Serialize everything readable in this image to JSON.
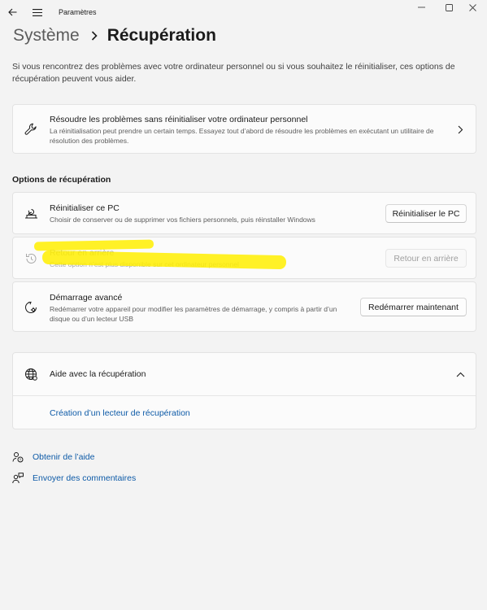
{
  "window": {
    "title": "Paramètres"
  },
  "breadcrumb": {
    "parent": "Système",
    "current": "Récupération"
  },
  "intro": "Si vous rencontrez des problèmes avec votre ordinateur personnel ou si vous souhaitez le réinitialiser, ces options de récupération peuvent vous aider.",
  "troubleshoot": {
    "title": "Résoudre les problèmes sans réinitialiser votre ordinateur personnel",
    "description": "La réinitialisation peut prendre un certain temps. Essayez tout d’abord de résoudre les problèmes en exécutant un utilitaire de résolution des problèmes."
  },
  "recovery_options": {
    "heading": "Options de récupération",
    "items": [
      {
        "title": "Réinitialiser ce PC",
        "description": "Choisir de conserver ou de supprimer vos fichiers personnels, puis réinstaller Windows",
        "button": "Réinitialiser le PC",
        "enabled": true
      },
      {
        "title": "Retour en arrière",
        "description": "Cette option n’est plus disponible sur cet ordinateur personnel",
        "button": "Retour en arrière",
        "enabled": false
      },
      {
        "title": "Démarrage avancé",
        "description": "Redémarrer votre appareil pour modifier les paramètres de démarrage, y compris à partir d’un disque ou d’un lecteur USB",
        "button": "Redémarrer maintenant",
        "enabled": true
      }
    ]
  },
  "help": {
    "title": "Aide avec la récupération",
    "expanded": true,
    "link": "Création d’un lecteur de récupération"
  },
  "footer": {
    "get_help": "Obtenir de l’aide",
    "feedback": "Envoyer des commentaires"
  },
  "colors": {
    "background": "#f3f3f3",
    "card": "#fbfbfb",
    "link": "#0d5aa7",
    "highlight": "#ffee00"
  },
  "icons": {
    "back": "arrow-left-icon",
    "menu": "hamburger-icon",
    "troubleshoot": "wrench-icon",
    "reset": "reset-pc-icon",
    "go_back": "history-icon",
    "advanced": "restart-gear-icon",
    "help": "globe-icon",
    "get_help": "help-person-icon",
    "feedback": "feedback-icon"
  }
}
